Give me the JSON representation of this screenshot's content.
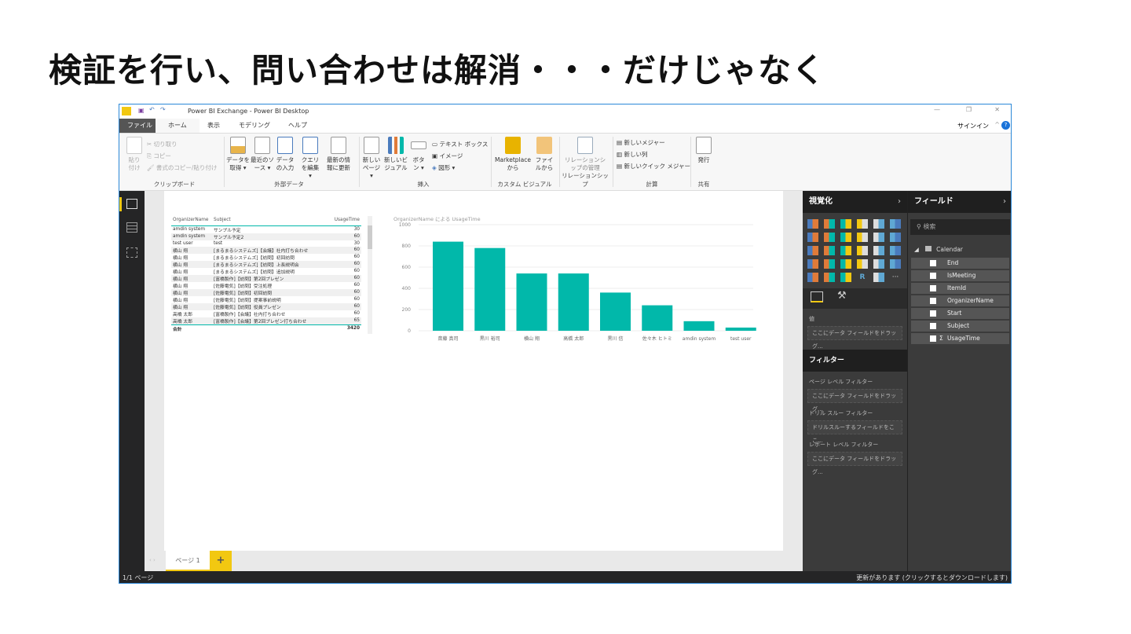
{
  "slide": {
    "title": "検証を行い、問い合わせは解消・・・だけじゃなく"
  },
  "window": {
    "title": "Power BI Exchange - Power BI Desktop",
    "signin": "サインイン",
    "minimize": "—",
    "restore": "❐",
    "close": "✕",
    "help": "?",
    "collapse": "^"
  },
  "tabs": [
    "ファイル",
    "ホーム",
    "表示",
    "モデリング",
    "ヘルプ"
  ],
  "ribbon": {
    "paste": "貼り付け",
    "cut": "切り取り",
    "copy": "コピー",
    "format_painter": "書式のコピー/貼り付け",
    "clipboard": "クリップボード",
    "get_data": "データを取得 ▾",
    "recent": "最近のソース ▾",
    "enter_data": "データの入力",
    "edit_query": "クエリを編集 ▾",
    "refresh": "最新の情報に更新",
    "external": "外部データ",
    "new_page": "新しいページ ▾",
    "new_visual": "新しいビジュアル",
    "buttons": "ボタン ▾",
    "textbox": "テキスト ボックス",
    "image": "イメージ",
    "shapes": "図形 ▾",
    "insert": "挿入",
    "marketplace": "Marketplaceから",
    "from_file": "ファイルから",
    "custom_visual": "カスタム ビジュアル",
    "manage_rel": "リレーションシップの管理",
    "relationship": "リレーションシップ",
    "new_measure": "新しいメジャー",
    "new_column": "新しい列",
    "new_quick": "新しいクイック メジャー",
    "calc": "計算",
    "publish": "発行",
    "share": "共有"
  },
  "table": {
    "headers": [
      "OrganizerName",
      "Subject",
      "UsageTime"
    ],
    "rows": [
      [
        "amdin system",
        "サンプル予定",
        "30"
      ],
      [
        "amdin system",
        "サンプル予定2",
        "60"
      ],
      [
        "test user",
        "test",
        "30"
      ],
      [
        "横山 翔",
        "[まるまるシステムズ]【会議】社内打ち合わせ",
        "60"
      ],
      [
        "横山 翔",
        "[まるまるシステムズ]【訪問】初回訪問",
        "60"
      ],
      [
        "横山 翔",
        "[まるまるシステムズ]【訪問】上長説明会",
        "60"
      ],
      [
        "横山 翔",
        "[まるまるシステムズ]【訪問】追加説明",
        "60"
      ],
      [
        "横山 翔",
        "[富橋製作]【訪問】第2回プレゼン",
        "60"
      ],
      [
        "横山 翔",
        "[佐藤電気]【訪問】受注処理",
        "60"
      ],
      [
        "横山 翔",
        "[佐藤電気]【訪問】初回訪問",
        "60"
      ],
      [
        "横山 翔",
        "[佐藤電気]【訪問】提案事前説明",
        "60"
      ],
      [
        "横山 翔",
        "[佐藤電気]【訪問】役員プレゼン",
        "60"
      ],
      [
        "高橋 太郎",
        "[富橋製作]【会議】社内打ち合わせ",
        "60"
      ],
      [
        "高橋 太郎",
        "[富橋製作]【会議】第2回プレゼン打ち合わせ",
        "65"
      ]
    ],
    "total_label": "合計",
    "total": "3420"
  },
  "chart_data": {
    "type": "bar",
    "title": "OrganizerName による UsageTime",
    "color": "#01b8aa",
    "categories": [
      "斎藤 真司",
      "黒川 裕司",
      "横山 翔",
      "高橋 太郎",
      "黒川 信",
      "佐々木 ヒトミ",
      "amdin system",
      "test user"
    ],
    "values": [
      840,
      780,
      540,
      540,
      360,
      240,
      90,
      30
    ],
    "ylim": [
      0,
      1000
    ],
    "yticks": [
      0,
      200,
      400,
      600,
      800,
      1000
    ],
    "grid": true,
    "xlabel": "",
    "ylabel": ""
  },
  "viz": {
    "title": "視覚化",
    "values_label": "値",
    "values_drop": "ここにデータ フィールドをドラッグ...",
    "filters_title": "フィルター",
    "page_filter": "ページ レベル フィルター",
    "page_drop": "ここにデータ フィールドをドラッグ...",
    "drill_filter": "ドリル スルー フィルター",
    "drill_drop": "ドリルスルーするフィールドをここ...",
    "report_filter": "レポート レベル フィルター",
    "report_drop": "ここにデータ フィールドをドラッグ..."
  },
  "fields": {
    "title": "フィールド",
    "search_placeholder": "検索",
    "table_name": "Calendar",
    "items": [
      "End",
      "IsMeeting",
      "ItemId",
      "OrganizerName",
      "Start",
      "Subject",
      "UsageTime"
    ]
  },
  "pages": {
    "tab": "ページ 1",
    "add": "+",
    "count": "1/1 ページ"
  },
  "status": {
    "update": "更新があります (クリックするとダウンロードします)"
  }
}
